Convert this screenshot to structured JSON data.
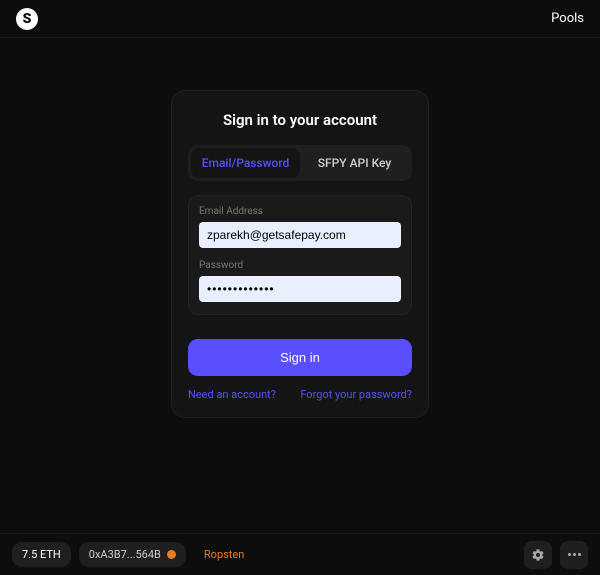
{
  "header": {
    "logo_letter": "S",
    "nav_pools": "Pools"
  },
  "signin": {
    "title": "Sign in to your account",
    "tabs": {
      "email_tab": "Email/Password",
      "api_tab": "SFPY API Key"
    },
    "email_label": "Email Address",
    "email_value": "zparekh@getsafepay.com",
    "password_label": "Password",
    "password_value": "•••••••••••••",
    "submit_label": "Sign in",
    "need_account": "Need an account?",
    "forgot_password": "Forgot your password?"
  },
  "footer": {
    "balance": "7.5 ETH",
    "address": "0xA3B7...564B",
    "network": "Ropsten"
  }
}
